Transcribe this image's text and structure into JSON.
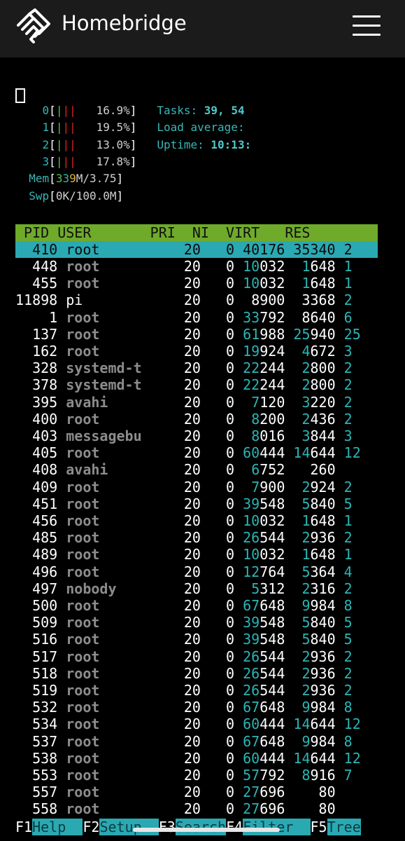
{
  "navbar": {
    "brand": "Homebridge"
  },
  "meters": {
    "cpu": [
      {
        "label": "0",
        "percent": "16.9%"
      },
      {
        "label": "1",
        "percent": "19.5%"
      },
      {
        "label": "2",
        "percent": "13.0%"
      },
      {
        "label": "3",
        "percent": "17.8%"
      }
    ],
    "mem": {
      "label": "Mem",
      "used_a": "3",
      "used_b": "3",
      "used_c": "9",
      "rest": "M/3.75"
    },
    "swp": {
      "label": "Swp",
      "value": "0K/100.0M"
    }
  },
  "stats": {
    "tasks_label": "Tasks:",
    "tasks_value": "39, 54",
    "load_label": "Load average:",
    "uptime_label": "Uptime:",
    "uptime_value": "10:13:"
  },
  "table": {
    "header": " PID USER       PRI  NI  VIRT   RES   ",
    "selected": {
      "pid": "410",
      "user": "root",
      "pri": "20",
      "ni": "0",
      "virt": "40176",
      "res": "35340",
      "shr": "2"
    },
    "rows": [
      {
        "pid": "448",
        "user": "root",
        "pri": "20",
        "ni": "0",
        "v1": "10",
        "v2": "032",
        "r1": "1",
        "r2": "648",
        "s": "1"
      },
      {
        "pid": "455",
        "user": "root",
        "pri": "20",
        "ni": "0",
        "v1": "10",
        "v2": "032",
        "r1": "1",
        "r2": "648",
        "s": "1"
      },
      {
        "pid": "11898",
        "user": "pi",
        "pri": "20",
        "ni": "0",
        "v1": "",
        "v2": "8900",
        "r1": "",
        "r2": "3368",
        "s": "2"
      },
      {
        "pid": "1",
        "user": "root",
        "pri": "20",
        "ni": "0",
        "v1": "33",
        "v2": "792",
        "r1": "",
        "r2": "8640",
        "s": "6"
      },
      {
        "pid": "137",
        "user": "root",
        "pri": "20",
        "ni": "0",
        "v1": "61",
        "v2": "988",
        "r1": "25",
        "r2": "940",
        "s": "25"
      },
      {
        "pid": "162",
        "user": "root",
        "pri": "20",
        "ni": "0",
        "v1": "19",
        "v2": "924",
        "r1": "4",
        "r2": "672",
        "s": "3"
      },
      {
        "pid": "328",
        "user": "systemd-t",
        "pri": "20",
        "ni": "0",
        "v1": "22",
        "v2": "244",
        "r1": "2",
        "r2": "800",
        "s": "2"
      },
      {
        "pid": "378",
        "user": "systemd-t",
        "pri": "20",
        "ni": "0",
        "v1": "22",
        "v2": "244",
        "r1": "2",
        "r2": "800",
        "s": "2"
      },
      {
        "pid": "395",
        "user": "avahi",
        "pri": "20",
        "ni": "0",
        "v1": "7",
        "v2": "120",
        "r1": "3",
        "r2": "220",
        "s": "2"
      },
      {
        "pid": "400",
        "user": "root",
        "pri": "20",
        "ni": "0",
        "v1": "8",
        "v2": "200",
        "r1": "2",
        "r2": "436",
        "s": "2"
      },
      {
        "pid": "403",
        "user": "messagebu",
        "pri": "20",
        "ni": "0",
        "v1": "8",
        "v2": "016",
        "r1": "3",
        "r2": "844",
        "s": "3"
      },
      {
        "pid": "405",
        "user": "root",
        "pri": "20",
        "ni": "0",
        "v1": "60",
        "v2": "444",
        "r1": "14",
        "r2": "644",
        "s": "12"
      },
      {
        "pid": "408",
        "user": "avahi",
        "pri": "20",
        "ni": "0",
        "v1": "6",
        "v2": "752",
        "r1": "",
        "r2": "260",
        "s": ""
      },
      {
        "pid": "409",
        "user": "root",
        "pri": "20",
        "ni": "0",
        "v1": "7",
        "v2": "900",
        "r1": "2",
        "r2": "924",
        "s": "2"
      },
      {
        "pid": "451",
        "user": "root",
        "pri": "20",
        "ni": "0",
        "v1": "39",
        "v2": "548",
        "r1": "5",
        "r2": "840",
        "s": "5"
      },
      {
        "pid": "456",
        "user": "root",
        "pri": "20",
        "ni": "0",
        "v1": "10",
        "v2": "032",
        "r1": "1",
        "r2": "648",
        "s": "1"
      },
      {
        "pid": "485",
        "user": "root",
        "pri": "20",
        "ni": "0",
        "v1": "26",
        "v2": "544",
        "r1": "2",
        "r2": "936",
        "s": "2"
      },
      {
        "pid": "489",
        "user": "root",
        "pri": "20",
        "ni": "0",
        "v1": "10",
        "v2": "032",
        "r1": "1",
        "r2": "648",
        "s": "1"
      },
      {
        "pid": "496",
        "user": "root",
        "pri": "20",
        "ni": "0",
        "v1": "12",
        "v2": "764",
        "r1": "5",
        "r2": "364",
        "s": "4"
      },
      {
        "pid": "497",
        "user": "nobody",
        "pri": "20",
        "ni": "0",
        "v1": "5",
        "v2": "312",
        "r1": "2",
        "r2": "316",
        "s": "2"
      },
      {
        "pid": "500",
        "user": "root",
        "pri": "20",
        "ni": "0",
        "v1": "67",
        "v2": "648",
        "r1": "9",
        "r2": "984",
        "s": "8"
      },
      {
        "pid": "509",
        "user": "root",
        "pri": "20",
        "ni": "0",
        "v1": "39",
        "v2": "548",
        "r1": "5",
        "r2": "840",
        "s": "5"
      },
      {
        "pid": "516",
        "user": "root",
        "pri": "20",
        "ni": "0",
        "v1": "39",
        "v2": "548",
        "r1": "5",
        "r2": "840",
        "s": "5"
      },
      {
        "pid": "517",
        "user": "root",
        "pri": "20",
        "ni": "0",
        "v1": "26",
        "v2": "544",
        "r1": "2",
        "r2": "936",
        "s": "2"
      },
      {
        "pid": "518",
        "user": "root",
        "pri": "20",
        "ni": "0",
        "v1": "26",
        "v2": "544",
        "r1": "2",
        "r2": "936",
        "s": "2"
      },
      {
        "pid": "519",
        "user": "root",
        "pri": "20",
        "ni": "0",
        "v1": "26",
        "v2": "544",
        "r1": "2",
        "r2": "936",
        "s": "2"
      },
      {
        "pid": "532",
        "user": "root",
        "pri": "20",
        "ni": "0",
        "v1": "67",
        "v2": "648",
        "r1": "9",
        "r2": "984",
        "s": "8"
      },
      {
        "pid": "534",
        "user": "root",
        "pri": "20",
        "ni": "0",
        "v1": "60",
        "v2": "444",
        "r1": "14",
        "r2": "644",
        "s": "12"
      },
      {
        "pid": "537",
        "user": "root",
        "pri": "20",
        "ni": "0",
        "v1": "67",
        "v2": "648",
        "r1": "9",
        "r2": "984",
        "s": "8"
      },
      {
        "pid": "538",
        "user": "root",
        "pri": "20",
        "ni": "0",
        "v1": "60",
        "v2": "444",
        "r1": "14",
        "r2": "644",
        "s": "12"
      },
      {
        "pid": "553",
        "user": "root",
        "pri": "20",
        "ni": "0",
        "v1": "57",
        "v2": "792",
        "r1": "8",
        "r2": "916",
        "s": "7"
      },
      {
        "pid": "557",
        "user": "root",
        "pri": "20",
        "ni": "0",
        "v1": "27",
        "v2": "696",
        "r1": "",
        "r2": "80",
        "s": ""
      },
      {
        "pid": "558",
        "user": "root",
        "pri": "20",
        "ni": "0",
        "v1": "27",
        "v2": "696",
        "r1": "",
        "r2": "80",
        "s": ""
      }
    ]
  },
  "function_keys": [
    {
      "key": "F1",
      "label": "Help  "
    },
    {
      "key": "F2",
      "label": "Setup  "
    },
    {
      "key": "F3",
      "label": "Search"
    },
    {
      "key": "F4",
      "label": "Filter  "
    },
    {
      "key": "F5",
      "label": "Tree"
    }
  ],
  "colors": {
    "header_bg": "#6faa2a",
    "selected_bg": "#2aa9b3",
    "accent": "#38b7b6"
  }
}
